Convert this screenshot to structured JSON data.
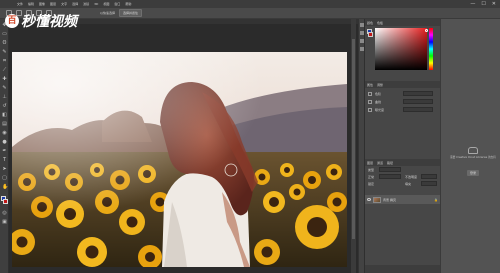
{
  "watermark": {
    "logo": "百",
    "text": "秒懂视频"
  },
  "menubar": {
    "items": [
      "文件",
      "编辑",
      "图像",
      "图层",
      "文字",
      "选择",
      "滤镜",
      "3D",
      "视图",
      "窗口",
      "帮助"
    ],
    "minimize": "—",
    "maximize": "☐",
    "close": "✕"
  },
  "optionsbar": {
    "item1": "以快速选择",
    "item2": "选择并遮住"
  },
  "panels": {
    "color_tabs": [
      "颜色",
      "色板"
    ],
    "adjust_tabs": [
      "属性",
      "调整"
    ],
    "adjust_labels": [
      "色阶",
      "曲线",
      "曝光度"
    ],
    "layers_tabs": [
      "图层",
      "通道",
      "路径"
    ],
    "layers_controls": {
      "kind": "类型",
      "mode": "正常",
      "opacity_label": "不透明度",
      "lock_label": "锁定",
      "fill_label": "填充"
    },
    "layer_name": "背景 拷贝"
  },
  "cc_libraries": {
    "text": "需要 Creative Cloud Libraries 的支持",
    "button": "登录"
  },
  "colors": {
    "foreground": "#1a3aa8",
    "background": "#c01818",
    "ui_dark": "#3c3c3c",
    "ui_panel": "#474747"
  }
}
